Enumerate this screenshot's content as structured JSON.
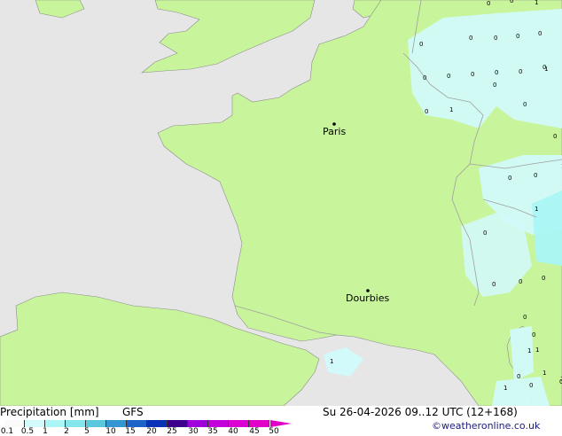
{
  "footer": {
    "title": "Precipitation [mm]",
    "model": "GFS",
    "datetime": "Su 26-04-2026 09..12 UTC (12+168)",
    "credit": "©weatheronline.co.uk"
  },
  "legend": {
    "ticks": [
      "0.1",
      "0.5",
      "1",
      "2",
      "5",
      "10",
      "15",
      "20",
      "25",
      "30",
      "35",
      "40",
      "45",
      "50"
    ],
    "colors": [
      "#fafafa",
      "#d2fafa",
      "#aaf5f5",
      "#82e6eb",
      "#5ac8dc",
      "#3296d2",
      "#1e64c8",
      "#0a32b4",
      "#3c008c",
      "#a000dc",
      "#c300dc",
      "#dc00d2",
      "#e000c8"
    ]
  },
  "colors": {
    "sea": "#e6e6e6",
    "land": "#c8f59b",
    "precip_light": "#d2fafa",
    "precip_medium": "#aaf5f5",
    "precip_heavy": "#82e6eb",
    "border": "#a0a0a0"
  },
  "cities": [
    {
      "name": "Paris"
    },
    {
      "name": "Dourbies"
    }
  ],
  "precip_values": [
    "0",
    "0",
    "1",
    "0",
    "0",
    "0",
    "0",
    "0",
    "0",
    "0",
    "0",
    "0",
    "0",
    "0",
    "0",
    "1",
    "0",
    "0",
    "0",
    "0",
    "0",
    "0",
    "0",
    "0",
    "0",
    "0",
    "1",
    "1",
    "0",
    "1",
    "1",
    "0",
    "0",
    "1",
    "1",
    "1",
    "1",
    "0",
    "1"
  ]
}
